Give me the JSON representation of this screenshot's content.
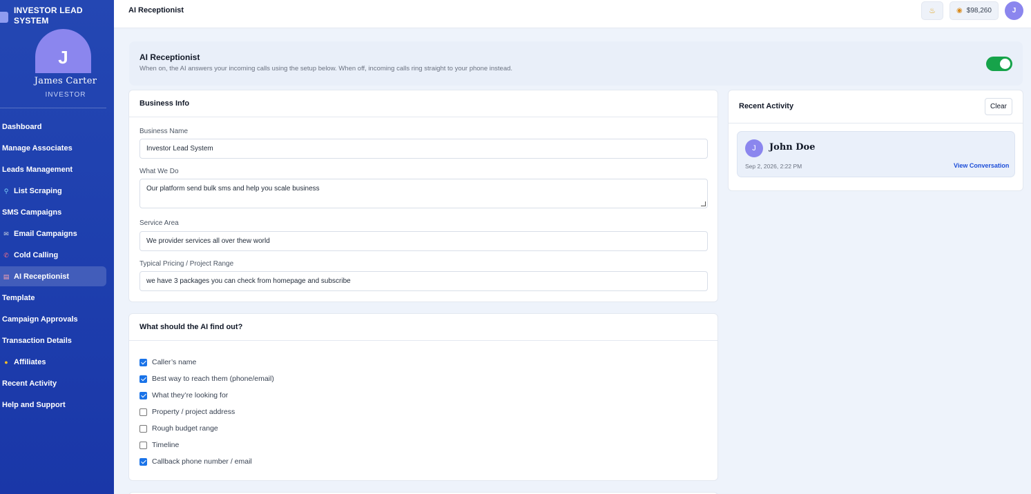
{
  "brand": {
    "name": "INVESTOR LEAD SYSTEM"
  },
  "profile": {
    "initial": "J",
    "name": "James Carter",
    "role": "INVESTOR"
  },
  "sidebar": {
    "items": [
      {
        "label": "Dashboard",
        "icon": ""
      },
      {
        "label": "Manage Associates",
        "icon": ""
      },
      {
        "label": "Leads Management",
        "icon": ""
      },
      {
        "label": "List Scraping",
        "icon": "magnifier-icon"
      },
      {
        "label": "SMS Campaigns",
        "icon": ""
      },
      {
        "label": "Email Campaigns",
        "icon": "email-icon"
      },
      {
        "label": "Cold Calling",
        "icon": "phone-icon"
      },
      {
        "label": "AI Receptionist",
        "icon": "robot-icon",
        "active": true
      },
      {
        "label": "Template",
        "icon": ""
      },
      {
        "label": "Campaign Approvals",
        "icon": ""
      },
      {
        "label": "Transaction Details",
        "icon": ""
      },
      {
        "label": "Affiliates",
        "icon": "handshake-icon"
      },
      {
        "label": "Recent Activity",
        "icon": ""
      },
      {
        "label": "Help and Support",
        "icon": ""
      }
    ]
  },
  "topbar": {
    "title": "AI Receptionist",
    "balance": "$98,260",
    "user_initial": "J"
  },
  "banner": {
    "title": "AI Receptionist",
    "description": "When on, the AI answers your incoming calls using the setup below. When off, incoming calls ring straight to your phone instead.",
    "enabled": true
  },
  "business_info": {
    "title": "Business Info",
    "fields": [
      {
        "label": "Business Name",
        "value": "Investor Lead System"
      },
      {
        "label": "What We Do",
        "value": "Our platform send bulk sms and help you scale business"
      },
      {
        "label": "Service Area",
        "value": "We provider services all over thew world"
      },
      {
        "label": "Typical Pricing / Project Range",
        "value": "we have 3 packages you can check from homepage and subscribe"
      }
    ]
  },
  "find_out": {
    "title": "What should the AI find out?",
    "options": [
      {
        "label": "Caller’s name",
        "checked": true
      },
      {
        "label": "Best way to reach them (phone/email)",
        "checked": true
      },
      {
        "label": "What they’re looking for",
        "checked": true
      },
      {
        "label": "Property / project address",
        "checked": false
      },
      {
        "label": "Rough budget range",
        "checked": false
      },
      {
        "label": "Timeline",
        "checked": false
      },
      {
        "label": "Callback phone number / email",
        "checked": true
      }
    ]
  },
  "recent_activity": {
    "title": "Recent Activity",
    "clear_label": "Clear",
    "items": [
      {
        "initial": "J",
        "name": "John Doe",
        "date": "Sep 2, 2026, 2:22 PM",
        "link": "View Conversation"
      }
    ]
  },
  "colors": {
    "sidebar": "#1e3fae",
    "accent": "#1d4ed8",
    "toggle_on": "#16a34a",
    "avatar": "#8b86ee"
  }
}
